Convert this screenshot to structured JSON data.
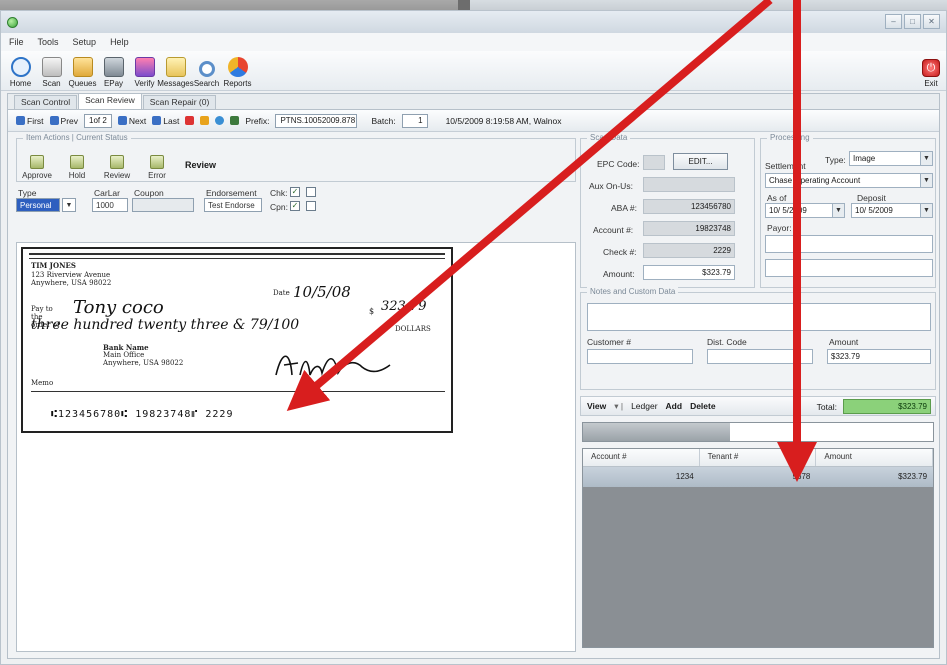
{
  "menu": [
    "File",
    "Tools",
    "Setup",
    "Help"
  ],
  "toolbar": {
    "tools": [
      {
        "label": "Home",
        "icon": "home-icon"
      },
      {
        "label": "Scan",
        "icon": "scanner-icon"
      },
      {
        "label": "Queues",
        "icon": "queue-folder-icon"
      },
      {
        "label": "EPay",
        "icon": "bank-icon"
      },
      {
        "label": "Verify",
        "icon": "verify-people-icon"
      },
      {
        "label": "Messages",
        "icon": "messages-envelope-icon"
      },
      {
        "label": "Search",
        "icon": "search-icon"
      },
      {
        "label": "Reports",
        "icon": "reports-pie-icon"
      }
    ],
    "exit_label": "Exit"
  },
  "tabs": [
    "Scan Control",
    "Scan Review",
    "Scan Repair (0)"
  ],
  "navbar": {
    "first": "First",
    "prev": "Prev",
    "position": "1of 2",
    "next": "Next",
    "last": "Last",
    "prefix_label": "Prefix:",
    "prefix_value": "PTNS.10052009.878",
    "batch_label": "Batch:",
    "batch_value": "1",
    "timestamp": "10/5/2009 8:19:58 AM, Walnox"
  },
  "item_actions": {
    "group_title": "Item Actions | Current Status",
    "actions": [
      "Approve",
      "Hold",
      "Review",
      "Error"
    ],
    "status": "Review"
  },
  "fields": {
    "type_label": "Type",
    "type_value": "Personal",
    "carlar_label": "CarLar",
    "carlar_value": "1000",
    "coupon_label": "Coupon",
    "endorsement_label": "Endorsement",
    "endorsement_value": "Test Endorse",
    "chk_label": "Chk:",
    "cpn_label": "Cpn:"
  },
  "check": {
    "name_line1": "TIM JONES",
    "name_line2": "123 Riverview Avenue",
    "name_line3": "Anywhere, USA  98022",
    "date_label": "Date",
    "date_value": "10/5/08",
    "payto_label": "Pay to the order of",
    "payee": "Tony coco",
    "amount_box": "323.79",
    "amount_words": "three hundred twenty three & 79/100",
    "dollars": "DOLLARS",
    "bank_name": "Bank Name",
    "bank_address1": "Main Office",
    "bank_address2": "Anywhere, USA  98022",
    "memo_label": "Memo",
    "micr": "⑆123456780⑆  19823748⑈  2229"
  },
  "scan_data": {
    "group_title": "Scan Data",
    "epc_label": "EPC Code:",
    "edit_label": "EDIT...",
    "aux_label": "Aux On-Us:",
    "aba_label": "ABA #:",
    "aba_value": "123456780",
    "account_label": "Account #:",
    "account_value": "19823748",
    "check_label": "Check #:",
    "check_value": "2229",
    "amount_label": "Amount:",
    "amount_value": "$323.79"
  },
  "processing": {
    "group_title": "Processing",
    "settlement_label": "Settlement",
    "type_label": "Type:",
    "type_value": "Image",
    "account_value": "Chase Operating Account",
    "asof_label": "As of",
    "asof_value": "10/ 5/2009",
    "deposit_label": "Deposit",
    "deposit_value": "10/ 5/2009",
    "payor_label": "Payor:"
  },
  "notes": {
    "group_title": "Notes and Custom Data",
    "customer_label": "Customer #",
    "dist_label": "Dist. Code",
    "amount_label": "Amount",
    "amount_value": "$323.79"
  },
  "ledger": {
    "view": "View",
    "ledger": "Ledger",
    "add": "Add",
    "delete": "Delete",
    "total_label": "Total:",
    "total_value": "$323.79",
    "progress": 0.42,
    "columns": [
      "Account #",
      "Tenant #",
      "Amount"
    ],
    "rows": [
      [
        "1234",
        "5678",
        "$323.79"
      ]
    ]
  },
  "colors": {
    "arrow": "#d81e1e",
    "total_green": "#8bd17a",
    "selection_blue": "#2e5fbf"
  }
}
